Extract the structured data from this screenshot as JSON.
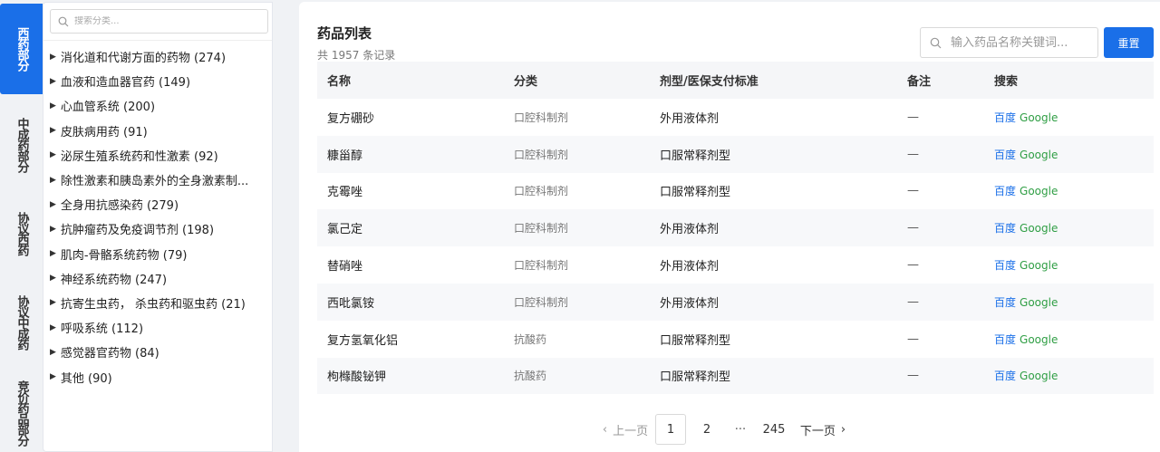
{
  "tabs": [
    {
      "label": "西药部分",
      "active": true
    },
    {
      "label": "中成药部分",
      "active": false
    },
    {
      "label": "协议西药",
      "active": false
    },
    {
      "label": "协议中成药",
      "active": false
    },
    {
      "label": "竞价药品部分",
      "active": false
    }
  ],
  "category_search": {
    "placeholder": "搜索分类..."
  },
  "categories": [
    "消化道和代谢方面的药物 (274)",
    "血液和造血器官药 (149)",
    "心血管系统 (200)",
    "皮肤病用药 (91)",
    "泌尿生殖系统药和性激素 (92)",
    "除性激素和胰岛素外的全身激素制...",
    "全身用抗感染药 (279)",
    "抗肿瘤药及免疫调节剂 (198)",
    "肌肉-骨骼系统药物 (79)",
    "神经系统药物 (247)",
    "抗寄生虫药， 杀虫药和驱虫药 (21)",
    "呼吸系统 (112)",
    "感觉器官药物 (84)",
    "其他 (90)"
  ],
  "main": {
    "title": "药品列表",
    "count_prefix": "共",
    "count": "1957",
    "count_suffix": "条记录",
    "search_placeholder": "输入药品名称关键词...",
    "reset_label": "重置"
  },
  "table": {
    "headers": [
      "名称",
      "分类",
      "剂型/医保支付标准",
      "备注",
      "搜索"
    ],
    "rows": [
      {
        "name": "复方硼砂",
        "category": "口腔科制剂",
        "form": "外用液体剂",
        "note": "—",
        "baidu": "百度",
        "google": "Google"
      },
      {
        "name": "糠甾醇",
        "category": "口腔科制剂",
        "form": "口服常释剂型",
        "note": "—",
        "baidu": "百度",
        "google": "Google"
      },
      {
        "name": "克霉唑",
        "category": "口腔科制剂",
        "form": "口服常释剂型",
        "note": "—",
        "baidu": "百度",
        "google": "Google"
      },
      {
        "name": "氯己定",
        "category": "口腔科制剂",
        "form": "外用液体剂",
        "note": "—",
        "baidu": "百度",
        "google": "Google"
      },
      {
        "name": "替硝唑",
        "category": "口腔科制剂",
        "form": "外用液体剂",
        "note": "—",
        "baidu": "百度",
        "google": "Google"
      },
      {
        "name": "西吡氯铵",
        "category": "口腔科制剂",
        "form": "外用液体剂",
        "note": "—",
        "baidu": "百度",
        "google": "Google"
      },
      {
        "name": "复方氢氧化铝",
        "category": "抗酸药",
        "form": "口服常释剂型",
        "note": "—",
        "baidu": "百度",
        "google": "Google"
      },
      {
        "name": "枸橼酸铋钾",
        "category": "抗酸药",
        "form": "口服常释剂型",
        "note": "—",
        "baidu": "百度",
        "google": "Google"
      }
    ]
  },
  "pagination": {
    "prev": "上一页",
    "pages": [
      "1",
      "2"
    ],
    "ellipsis": "···",
    "last": "245",
    "next": "下一页",
    "current": "1"
  },
  "colors": {
    "accent": "#1a6fe8",
    "google_link": "#2f9e44"
  },
  "icons": {
    "search": "search-icon",
    "prev": "chevron-left-icon",
    "next": "chevron-right-icon",
    "expand": "caret-right-icon"
  }
}
